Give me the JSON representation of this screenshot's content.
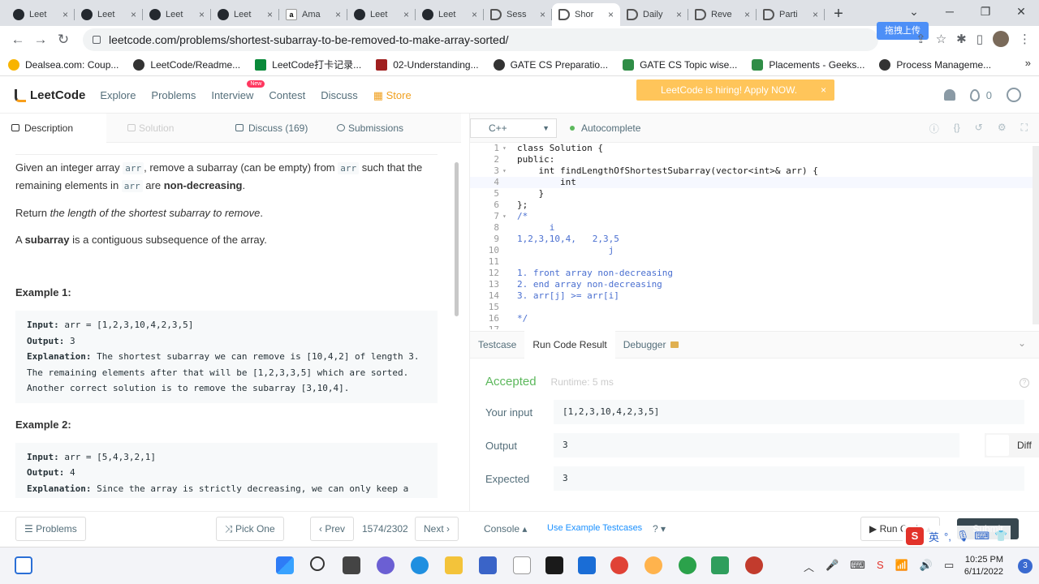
{
  "browser": {
    "tabs": [
      {
        "label": "Leet",
        "icon": "github-icon"
      },
      {
        "label": "Leet",
        "icon": "github-icon"
      },
      {
        "label": "Leet",
        "icon": "github-icon"
      },
      {
        "label": "Leet",
        "icon": "github-icon"
      },
      {
        "label": "Ama",
        "icon": "amazon-icon"
      },
      {
        "label": "Leet",
        "icon": "github-icon"
      },
      {
        "label": "Leet",
        "icon": "github-icon"
      },
      {
        "label": "Sess",
        "icon": "leetcode-icon"
      },
      {
        "label": "Shor",
        "icon": "leetcode-icon",
        "active": true
      },
      {
        "label": "Daily",
        "icon": "leetcode-icon"
      },
      {
        "label": "Reve",
        "icon": "leetcode-icon"
      },
      {
        "label": "Parti",
        "icon": "leetcode-icon"
      }
    ],
    "new_tab": "+",
    "url": "leetcode.com/problems/shortest-subarray-to-be-removed-to-make-array-sorted/",
    "upload_badge": "拖拽上传",
    "bookmarks": [
      "Dealsea.com: Coup...",
      "LeetCode/Readme...",
      "LeetCode打卡记录...",
      "02-Understanding...",
      "GATE CS Preparatio...",
      "GATE CS Topic wise...",
      "Placements - Geeks...",
      "Process Manageme..."
    ],
    "bookmarks_more": "»"
  },
  "lc_header": {
    "logo": "LeetCode",
    "nav": [
      "Explore",
      "Problems",
      "Interview",
      "Contest",
      "Discuss",
      "Store"
    ],
    "new_badge": "New",
    "hiring": "LeetCode is hiring! Apply NOW.",
    "hiring_close": "×",
    "coins": "0"
  },
  "desc_tabs": [
    {
      "label": "Description"
    },
    {
      "label": "Solution"
    },
    {
      "label": "Discuss (169)"
    },
    {
      "label": "Submissions"
    }
  ],
  "problem": {
    "p1_a": "Given an integer array ",
    "p1_code1": "arr",
    "p1_b": ", remove a subarray (can be empty) from ",
    "p1_code2": "arr",
    "p1_c": " such that the remaining elements in ",
    "p1_code3": "arr",
    "p1_d": " are ",
    "p1_bold": "non-decreasing",
    "p1_e": ".",
    "p2_a": "Return ",
    "p2_em": "the length of the shortest subarray to remove",
    "p2_b": ".",
    "p3_a": "A ",
    "p3_bold": "subarray",
    "p3_b": " is a contiguous subsequence of the array.",
    "ex1_title": "Example 1:",
    "ex1_input_label": "Input:",
    "ex1_input": " arr = [1,2,3,10,4,2,3,5]",
    "ex1_output_label": "Output:",
    "ex1_output": " 3",
    "ex1_expl_label": "Explanation:",
    "ex1_expl_1": " The shortest subarray we can remove is [10,4,2] of length 3.",
    "ex1_expl_2": "The remaining elements after that will be [1,2,3,3,5] which are sorted.",
    "ex1_expl_3": "Another correct solution is to remove the subarray [3,10,4].",
    "ex2_title": "Example 2:",
    "ex2_input_label": "Input:",
    "ex2_input": " arr = [5,4,3,2,1]",
    "ex2_output_label": "Output:",
    "ex2_output": " 4",
    "ex2_expl_label": "Explanation:",
    "ex2_expl_1": " Since the array is strictly decreasing, we can only keep a"
  },
  "editor": {
    "language": "C++",
    "autocomplete": "Autocomplete",
    "lines": [
      {
        "n": "1",
        "fold": "▾",
        "text": "class Solution {",
        "cm": false
      },
      {
        "n": "2",
        "fold": "",
        "text": "public:",
        "cm": false
      },
      {
        "n": "3",
        "fold": "▾",
        "text": "    int findLengthOfShortestSubarray(vector<int>& arr) {",
        "cm": false
      },
      {
        "n": "4",
        "fold": "",
        "text": "        int ",
        "cm": false,
        "cur": true
      },
      {
        "n": "5",
        "fold": "",
        "text": "    }",
        "cm": false
      },
      {
        "n": "6",
        "fold": "",
        "text": "};",
        "cm": false
      },
      {
        "n": "7",
        "fold": "▾",
        "text": "/*",
        "cm": true
      },
      {
        "n": "8",
        "fold": "",
        "text": "      i",
        "cm": true
      },
      {
        "n": "9",
        "fold": "",
        "text": "1,2,3,10,4,   2,3,5",
        "cm": true
      },
      {
        "n": "10",
        "fold": "",
        "text": "                 j",
        "cm": true
      },
      {
        "n": "11",
        "fold": "",
        "text": "",
        "cm": true
      },
      {
        "n": "12",
        "fold": "",
        "text": "1. front array non-decreasing",
        "cm": true
      },
      {
        "n": "13",
        "fold": "",
        "text": "2. end array non-decreasing",
        "cm": true
      },
      {
        "n": "14",
        "fold": "",
        "text": "3. arr[j] >= arr[i]",
        "cm": true
      },
      {
        "n": "15",
        "fold": "",
        "text": "",
        "cm": true
      },
      {
        "n": "16",
        "fold": "",
        "text": "*/",
        "cm": true
      },
      {
        "n": "17",
        "fold": "",
        "text": "",
        "cm": false
      }
    ]
  },
  "bottom_tabs": [
    "Testcase",
    "Run Code Result",
    "Debugger"
  ],
  "result": {
    "status": "Accepted",
    "runtime": "Runtime: 5 ms",
    "help": "?",
    "input_label": "Your input",
    "input_value": "[1,2,3,10,4,2,3,5]",
    "output_label": "Output",
    "output_value": "3",
    "diff_label": "Diff",
    "expected_label": "Expected",
    "expected_value": "3"
  },
  "footer": {
    "problems": "Problems",
    "pick_one": "Pick One",
    "prev": "Prev",
    "page": "1574/2302",
    "next": "Next",
    "console": "Console",
    "use_example": "Use Example Testcases",
    "run_code": "Run Code",
    "submit": "Submit"
  },
  "ime": {
    "s": "S",
    "lang": "英"
  },
  "taskbar": {
    "time": "10:25 PM",
    "date": "6/11/2022",
    "notifications": "3"
  }
}
